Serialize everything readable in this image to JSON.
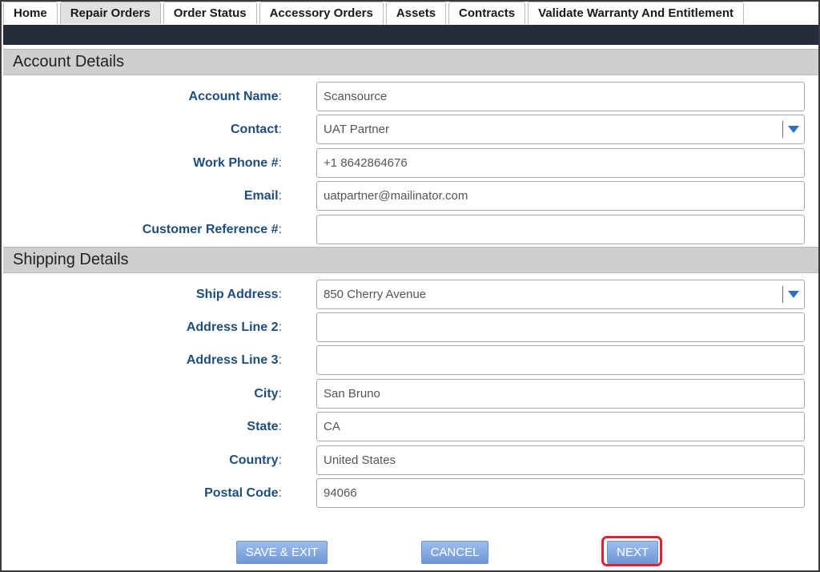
{
  "tabs": [
    {
      "label": "Home"
    },
    {
      "label": "Repair Orders",
      "active": true
    },
    {
      "label": "Order Status"
    },
    {
      "label": "Accessory Orders"
    },
    {
      "label": "Assets"
    },
    {
      "label": "Contracts"
    },
    {
      "label": "Validate Warranty And Entitlement"
    }
  ],
  "account": {
    "title": "Account Details",
    "account_name": {
      "label": "Account Name",
      "value": "Scansource"
    },
    "contact": {
      "label": "Contact",
      "value": "UAT Partner"
    },
    "work_phone": {
      "label": "Work Phone #",
      "value": "+1 8642864676"
    },
    "email": {
      "label": "Email",
      "value": "uatpartner@mailinator.com"
    },
    "customer_ref": {
      "label": "Customer Reference #",
      "value": ""
    }
  },
  "shipping": {
    "title": "Shipping Details",
    "ship_address": {
      "label": "Ship Address",
      "value": "850 Cherry Avenue"
    },
    "address_line2": {
      "label": "Address Line 2",
      "value": ""
    },
    "address_line3": {
      "label": "Address Line 3",
      "value": ""
    },
    "city": {
      "label": "City",
      "value": "San Bruno"
    },
    "state": {
      "label": "State",
      "value": "CA"
    },
    "country": {
      "label": "Country",
      "value": "United States"
    },
    "postal_code": {
      "label": "Postal Code",
      "value": "94066"
    }
  },
  "buttons": {
    "save_exit": "SAVE & EXIT",
    "cancel": "CANCEL",
    "next": "NEXT"
  },
  "colors": {
    "label_blue": "#1f4d7a",
    "dark_bar": "#252b3a",
    "button_blue": "#7aa2dc",
    "highlight_red": "#e0202a"
  }
}
